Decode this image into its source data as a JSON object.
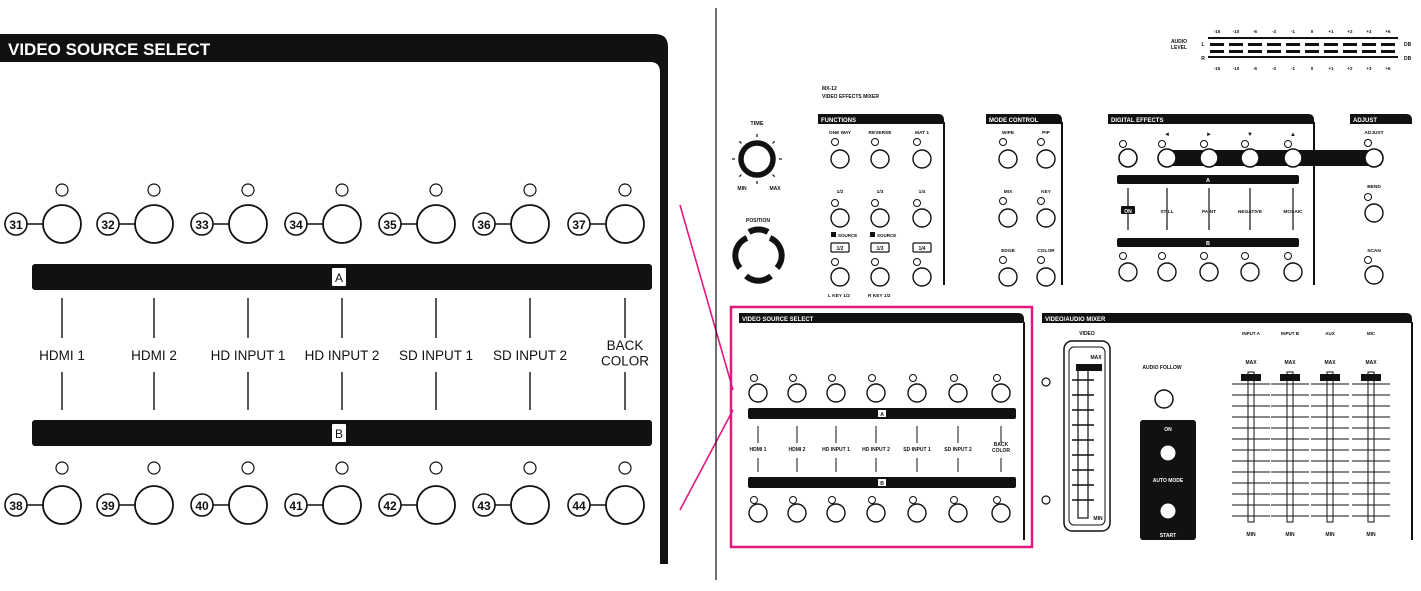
{
  "zoom": {
    "title": "VIDEO SOURCE SELECT",
    "buttons_a": [
      "31",
      "32",
      "33",
      "34",
      "35",
      "36",
      "37"
    ],
    "buttons_b": [
      "38",
      "39",
      "40",
      "41",
      "42",
      "43",
      "44"
    ],
    "bus_a": "A",
    "bus_b": "B",
    "sources": [
      "HDMI 1",
      "HDMI 2",
      "HD INPUT 1",
      "HD INPUT 2",
      "SD INPUT 1",
      "SD INPUT 2",
      "BACK\nCOLOR"
    ]
  },
  "panel": {
    "model": "MX-12",
    "model_sub": "VIDEO EFFECTS MIXER",
    "audio_level": {
      "label": "AUDIO\nLEVEL",
      "left": "L",
      "right": "R",
      "db": "DB",
      "scale": [
        "-15",
        "-10",
        "-6",
        "-3",
        "-1",
        "0",
        "+1",
        "+2",
        "+3",
        "+6"
      ]
    },
    "time": {
      "label": "TIME",
      "min": "MIN",
      "max": "MAX"
    },
    "position": {
      "label": "POSITION"
    },
    "functions": {
      "title": "FUNCTIONS",
      "row1": [
        "ONE WAY",
        "REVERSE",
        "MAT 1"
      ],
      "row2": [
        "1/2",
        "1/3",
        "1/4"
      ],
      "source_labels": [
        "SOURCE",
        "SOURCE"
      ],
      "boxes": [
        "1/2",
        "1/3",
        "1/4"
      ],
      "bottom": [
        "L KEY 1/2",
        "R KEY 1/2"
      ]
    },
    "mode_control": {
      "title": "MODE CONTROL",
      "row1": [
        "WIPE",
        "PIP"
      ],
      "row2": [
        "MIX",
        "KEY"
      ],
      "row3": [
        "EDGE",
        "COLOR"
      ]
    },
    "digital_effects": {
      "title": "DIGITAL EFFECTS",
      "arrows": [
        "◄",
        "►",
        "▼",
        "▲"
      ],
      "bus_a": "A",
      "bus_b": "B",
      "effects": [
        "ON",
        "STILL",
        "PAINT",
        "NEGATIVE",
        "MOSAIC"
      ]
    },
    "adjust": {
      "title": "ADJUST",
      "items": [
        "ADJUST",
        "BEND",
        "SCAN"
      ]
    },
    "video_source_select": {
      "title": "VIDEO SOURCE SELECT",
      "bus_a": "A",
      "bus_b": "B",
      "sources": [
        "HDMI 1",
        "HDMI 2",
        "HD INPUT 1",
        "HD INPUT 2",
        "SD INPUT 1",
        "SD INPUT 2",
        "BACK\nCOLOR"
      ]
    },
    "video_audio_mixer": {
      "title": "VIDEO/AUDIO MIXER",
      "video": "VIDEO",
      "max": "MAX",
      "min": "MIN",
      "audio_follow": "AUDIO FOLLOW",
      "on": "ON",
      "auto_mode": "AUTO MODE",
      "start": "START",
      "channels": [
        "INPUT A",
        "INPUT B",
        "AUX",
        "MIC"
      ],
      "ch_max": "MAX",
      "ch_min": "MIN"
    }
  }
}
